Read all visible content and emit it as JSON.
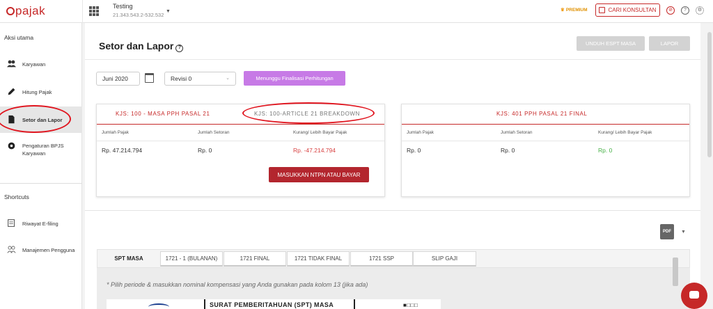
{
  "header": {
    "logo": "pajak",
    "company_name": "Testing",
    "npwp": "21.343.543.2-532.532",
    "premium_label": "PREMIUM",
    "cari_konsultan": "CARI KONSULTAN",
    "icons": [
      "apps-grid-icon",
      "notification-icon",
      "help-icon",
      "settings-icon"
    ]
  },
  "sidebar": {
    "main_heading": "Aksi utama",
    "items": [
      {
        "label": "Karyawan",
        "icon": "people-icon"
      },
      {
        "label": "Hitung Pajak",
        "icon": "pencil-icon"
      },
      {
        "label": "Setor dan Lapor",
        "icon": "document-icon"
      },
      {
        "label": "Pengaturan BPJS Karyawan",
        "icon": "gear-icon"
      }
    ],
    "shortcuts_heading": "Shortcuts",
    "shortcuts": [
      {
        "label": "Riwayat E-filing",
        "icon": "history-icon"
      },
      {
        "label": "Manajemen Pengguna",
        "icon": "users-icon"
      }
    ]
  },
  "page": {
    "title": "Setor dan Lapor",
    "unduh_button": "UNDUH ESPT MASA",
    "lapor_button": "LAPOR",
    "period": "Juni 2020",
    "revision": "Revisi 0",
    "status_button": "Menunggu Finalisasi Perhitungan"
  },
  "panel_left": {
    "tab_active": "KJS: 100 - MASA PPH PASAL 21",
    "tab_inactive": "KJS: 100-ARTICLE 21 BREAKDOWN",
    "headers": [
      "Jumlah Pajak",
      "Jumlah Setoran",
      "Kurang/ Lebih Bayar Pajak"
    ],
    "values": [
      "Rp. 47.214.794",
      "Rp. 0",
      "Rp. -47.214.794"
    ],
    "action_button": "MASUKKAN NTPN ATAU BAYAR"
  },
  "panel_right": {
    "tab_active": "KJS: 401 PPH PASAL 21 FINAL",
    "headers": [
      "Jumlah Pajak",
      "Jumlah Setoran",
      "Kurang/ Lebih Bayar Pajak"
    ],
    "values": [
      "Rp. 0",
      "Rp. 0",
      "Rp. 0"
    ]
  },
  "bottom_tabs": [
    "SPT MASA",
    "1721 - 1 (BULANAN)",
    "1721 FINAL",
    "1721 TIDAK FINAL",
    "1721 SSP",
    "SLIP GAJI"
  ],
  "note": "* Pilih periode & masukkan nominal kompensasi yang Anda gunakan pada kolom 13 (jika ada)",
  "document": {
    "title": "SURAT PEMBERITAHUAN (SPT) MASA",
    "boxes": "■□□□"
  },
  "pdf_label": "PDF",
  "colors": {
    "brand_red": "#c62828",
    "purple": "#c77ae6",
    "green": "#45b045"
  }
}
